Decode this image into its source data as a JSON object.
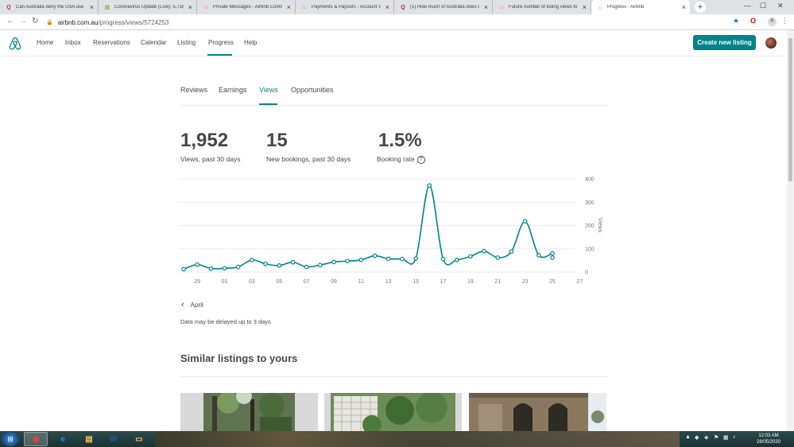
{
  "browser": {
    "tabs": [
      {
        "title": "Can Australia deny the USA use o",
        "icon": "quora-icon",
        "icon_glyph": "Q",
        "icon_color": "#b92b27"
      },
      {
        "title": "Coronavirus Update (Live): 5,716,",
        "icon": "worldometer-icon",
        "icon_glyph": "▥",
        "icon_color": "#9bbb3c"
      },
      {
        "title": "Private Messages - Airbnb Comm",
        "icon": "airbnb-icon",
        "icon_glyph": "⌂",
        "icon_color": "#ff5a5f"
      },
      {
        "title": "Payments & Payouts - Account Se",
        "icon": "airbnb-icon",
        "icon_glyph": "⌂",
        "icon_color": "#ff5a5f"
      },
      {
        "title": "(1) How much of Australia does C",
        "icon": "quora-icon",
        "icon_glyph": "Q",
        "icon_color": "#b92b27"
      },
      {
        "title": "Future number of listing views fo",
        "icon": "airbnb-icon",
        "icon_glyph": "⌂",
        "icon_color": "#ff5a5f"
      },
      {
        "title": "Progress - Airbnb",
        "icon": "airbnb-icon",
        "icon_glyph": "⌂",
        "icon_color": "#ff5a5f",
        "active": true
      }
    ],
    "new_tab": "+",
    "window_controls": {
      "minimize": "—",
      "maximize": "☐",
      "close": "✕"
    },
    "address": {
      "host": "airbnb.com.au",
      "path": "/progress/views/5724253"
    },
    "profile_initial": "R"
  },
  "header": {
    "nav": [
      "Home",
      "Inbox",
      "Reservations",
      "Calendar",
      "Listing",
      "Progress",
      "Help"
    ],
    "active_nav": "Progress",
    "create_button": "Create new listing"
  },
  "subtabs": [
    "Reviews",
    "Earnings",
    "Views",
    "Opportunities"
  ],
  "active_subtab": "Views",
  "stats": [
    {
      "value": "1,952",
      "label": "Views, past 30 days"
    },
    {
      "value": "15",
      "label": "New bookings, past 30 days"
    },
    {
      "value": "1.5%",
      "label": "Booking rate",
      "help": "?"
    }
  ],
  "chart_data": {
    "type": "line",
    "color": "#008489",
    "ylabel": "Views",
    "ylim": [
      0,
      400
    ],
    "yticks": [
      0,
      100,
      200,
      300,
      400
    ],
    "xticks": [
      "29",
      "01",
      "03",
      "05",
      "07",
      "09",
      "11",
      "13",
      "15",
      "17",
      "19",
      "21",
      "23",
      "25",
      "27"
    ],
    "x": [
      "28",
      "29",
      "30",
      "01",
      "02",
      "03",
      "04",
      "05",
      "06",
      "07",
      "08",
      "09",
      "10",
      "11",
      "12",
      "13",
      "14",
      "15",
      "16",
      "17",
      "18",
      "19",
      "20",
      "21",
      "22",
      "23",
      "24",
      "25"
    ],
    "values": [
      12,
      32,
      15,
      16,
      22,
      52,
      35,
      28,
      42,
      22,
      30,
      43,
      47,
      52,
      70,
      57,
      56,
      58,
      372,
      56,
      52,
      67,
      90,
      62,
      88,
      218,
      72,
      80
    ],
    "extra_point": {
      "x": "25",
      "value": 62
    }
  },
  "month_nav": {
    "label": "April",
    "icon": "chevron-left-icon"
  },
  "delay_note": "Data may be delayed up to 3 days",
  "similar": {
    "title": "Similar listings to yours",
    "cards": [
      {
        "photo": "garden-trees",
        "bg": "#5f7350"
      },
      {
        "photo": "courtyard-plants",
        "bg": "#6e8c5a"
      },
      {
        "photo": "sandstone-building",
        "bg": "#8a7860"
      }
    ]
  },
  "taskbar": {
    "start_icon": "windows-start-icon",
    "apps": [
      {
        "name": "chrome-icon",
        "glyph": "◉",
        "color": "#e94235",
        "active": true
      },
      {
        "name": "internet-explorer-icon",
        "glyph": "e",
        "color": "#1e90ff"
      },
      {
        "name": "file-explorer-icon",
        "glyph": "▤",
        "color": "#e8c565"
      },
      {
        "name": "word-icon",
        "glyph": "W",
        "color": "#2b579a"
      },
      {
        "name": "folder-icon",
        "glyph": "▭",
        "color": "#e8c565"
      }
    ],
    "clock_time": "12:03 AM",
    "clock_date": "28/05/2020"
  }
}
